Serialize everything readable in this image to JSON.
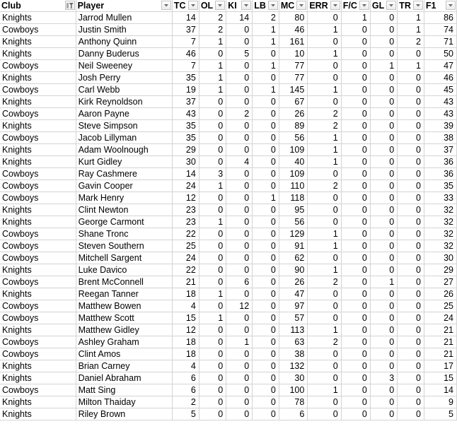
{
  "sheet": {
    "columns": [
      {
        "key": "club",
        "label": "Club",
        "filter_icon": "filter-active-icon",
        "align": "left"
      },
      {
        "key": "player",
        "label": "Player",
        "filter_icon": "dropdown-arrow-icon",
        "align": "left"
      },
      {
        "key": "tc",
        "label": "TC",
        "filter_icon": "dropdown-arrow-icon",
        "align": "right"
      },
      {
        "key": "ol",
        "label": "OL",
        "filter_icon": "dropdown-arrow-icon",
        "align": "right"
      },
      {
        "key": "ki",
        "label": "KI",
        "filter_icon": "dropdown-arrow-icon",
        "align": "right"
      },
      {
        "key": "lb",
        "label": "LB",
        "filter_icon": "dropdown-arrow-icon",
        "align": "right"
      },
      {
        "key": "mc",
        "label": "MC",
        "filter_icon": "dropdown-arrow-icon",
        "align": "right"
      },
      {
        "key": "err",
        "label": "ERR",
        "filter_icon": "dropdown-arrow-icon",
        "align": "right"
      },
      {
        "key": "fc",
        "label": "F/C",
        "filter_icon": "dropdown-arrow-icon",
        "align": "right"
      },
      {
        "key": "gl",
        "label": "GL",
        "filter_icon": "dropdown-arrow-icon",
        "align": "right"
      },
      {
        "key": "tr",
        "label": "TR",
        "filter_icon": "dropdown-arrow-icon",
        "align": "right"
      },
      {
        "key": "f1",
        "label": "F1",
        "filter_icon": "dropdown-arrow-icon",
        "align": "right"
      }
    ],
    "rows": [
      [
        "Knights",
        "Jarrod Mullen",
        14,
        2,
        14,
        2,
        80,
        0,
        1,
        0,
        1,
        86
      ],
      [
        "Cowboys",
        "Justin Smith",
        37,
        2,
        0,
        1,
        46,
        1,
        0,
        0,
        1,
        74
      ],
      [
        "Knights",
        "Anthony Quinn",
        7,
        1,
        0,
        1,
        161,
        0,
        0,
        0,
        2,
        71
      ],
      [
        "Knights",
        "Danny Buderus",
        46,
        0,
        5,
        0,
        10,
        1,
        0,
        0,
        0,
        50
      ],
      [
        "Cowboys",
        "Neil Sweeney",
        7,
        1,
        0,
        1,
        77,
        0,
        0,
        1,
        1,
        47
      ],
      [
        "Knights",
        "Josh Perry",
        35,
        1,
        0,
        0,
        77,
        0,
        0,
        0,
        0,
        46
      ],
      [
        "Cowboys",
        "Carl Webb",
        19,
        1,
        0,
        1,
        145,
        1,
        0,
        0,
        0,
        45
      ],
      [
        "Knights",
        "Kirk Reynoldson",
        37,
        0,
        0,
        0,
        67,
        0,
        0,
        0,
        0,
        43
      ],
      [
        "Cowboys",
        "Aaron Payne",
        43,
        0,
        2,
        0,
        26,
        2,
        0,
        0,
        0,
        43
      ],
      [
        "Knights",
        "Steve Simpson",
        35,
        0,
        0,
        0,
        89,
        2,
        0,
        0,
        0,
        39
      ],
      [
        "Cowboys",
        "Jacob Lillyman",
        35,
        0,
        0,
        0,
        56,
        1,
        0,
        0,
        0,
        38
      ],
      [
        "Knights",
        "Adam Woolnough",
        29,
        0,
        0,
        0,
        109,
        1,
        0,
        0,
        0,
        37
      ],
      [
        "Knights",
        "Kurt Gidley",
        30,
        0,
        4,
        0,
        40,
        1,
        0,
        0,
        0,
        36
      ],
      [
        "Cowboys",
        "Ray Cashmere",
        14,
        3,
        0,
        0,
        109,
        0,
        0,
        0,
        0,
        36
      ],
      [
        "Cowboys",
        "Gavin Cooper",
        24,
        1,
        0,
        0,
        110,
        2,
        0,
        0,
        0,
        35
      ],
      [
        "Cowboys",
        "Mark Henry",
        12,
        0,
        0,
        1,
        118,
        0,
        0,
        0,
        0,
        33
      ],
      [
        "Knights",
        "Clint Newton",
        23,
        0,
        0,
        0,
        95,
        0,
        0,
        0,
        0,
        32
      ],
      [
        "Knights",
        "George Carmont",
        23,
        1,
        0,
        0,
        56,
        0,
        0,
        0,
        0,
        32
      ],
      [
        "Cowboys",
        "Shane Tronc",
        22,
        0,
        0,
        0,
        129,
        1,
        0,
        0,
        0,
        32
      ],
      [
        "Cowboys",
        "Steven Southern",
        25,
        0,
        0,
        0,
        91,
        1,
        0,
        0,
        0,
        32
      ],
      [
        "Cowboys",
        "Mitchell Sargent",
        24,
        0,
        0,
        0,
        62,
        0,
        0,
        0,
        0,
        30
      ],
      [
        "Knights",
        "Luke Davico",
        22,
        0,
        0,
        0,
        90,
        1,
        0,
        0,
        0,
        29
      ],
      [
        "Cowboys",
        "Brent McConnell",
        21,
        0,
        6,
        0,
        26,
        2,
        0,
        1,
        0,
        27
      ],
      [
        "Knights",
        "Reegan Tanner",
        18,
        1,
        0,
        0,
        47,
        0,
        0,
        0,
        0,
        26
      ],
      [
        "Cowboys",
        "Matthew Bowen",
        4,
        0,
        12,
        0,
        97,
        0,
        0,
        0,
        0,
        25
      ],
      [
        "Cowboys",
        "Matthew Scott",
        15,
        1,
        0,
        0,
        57,
        0,
        0,
        0,
        0,
        24
      ],
      [
        "Knights",
        "Matthew Gidley",
        12,
        0,
        0,
        0,
        113,
        1,
        0,
        0,
        0,
        21
      ],
      [
        "Cowboys",
        "Ashley Graham",
        18,
        0,
        1,
        0,
        63,
        2,
        0,
        0,
        0,
        21
      ],
      [
        "Cowboys",
        "Clint Amos",
        18,
        0,
        0,
        0,
        38,
        0,
        0,
        0,
        0,
        21
      ],
      [
        "Knights",
        "Brian Carney",
        4,
        0,
        0,
        0,
        132,
        0,
        0,
        0,
        0,
        17
      ],
      [
        "Knights",
        "Daniel Abraham",
        6,
        0,
        0,
        0,
        30,
        0,
        0,
        3,
        0,
        15
      ],
      [
        "Cowboys",
        "Matt Sing",
        6,
        0,
        0,
        0,
        100,
        1,
        0,
        0,
        0,
        14
      ],
      [
        "Knights",
        "Milton Thaiday",
        2,
        0,
        0,
        0,
        78,
        0,
        0,
        0,
        0,
        9
      ],
      [
        "Knights",
        "Riley Brown",
        5,
        0,
        0,
        0,
        6,
        0,
        0,
        0,
        0,
        5
      ]
    ],
    "colors": {
      "gridline": "#d4d4d4",
      "text": "#000000",
      "filter_button_border": "#c4c4c4",
      "filter_glyph": "#6a6a6a"
    }
  }
}
